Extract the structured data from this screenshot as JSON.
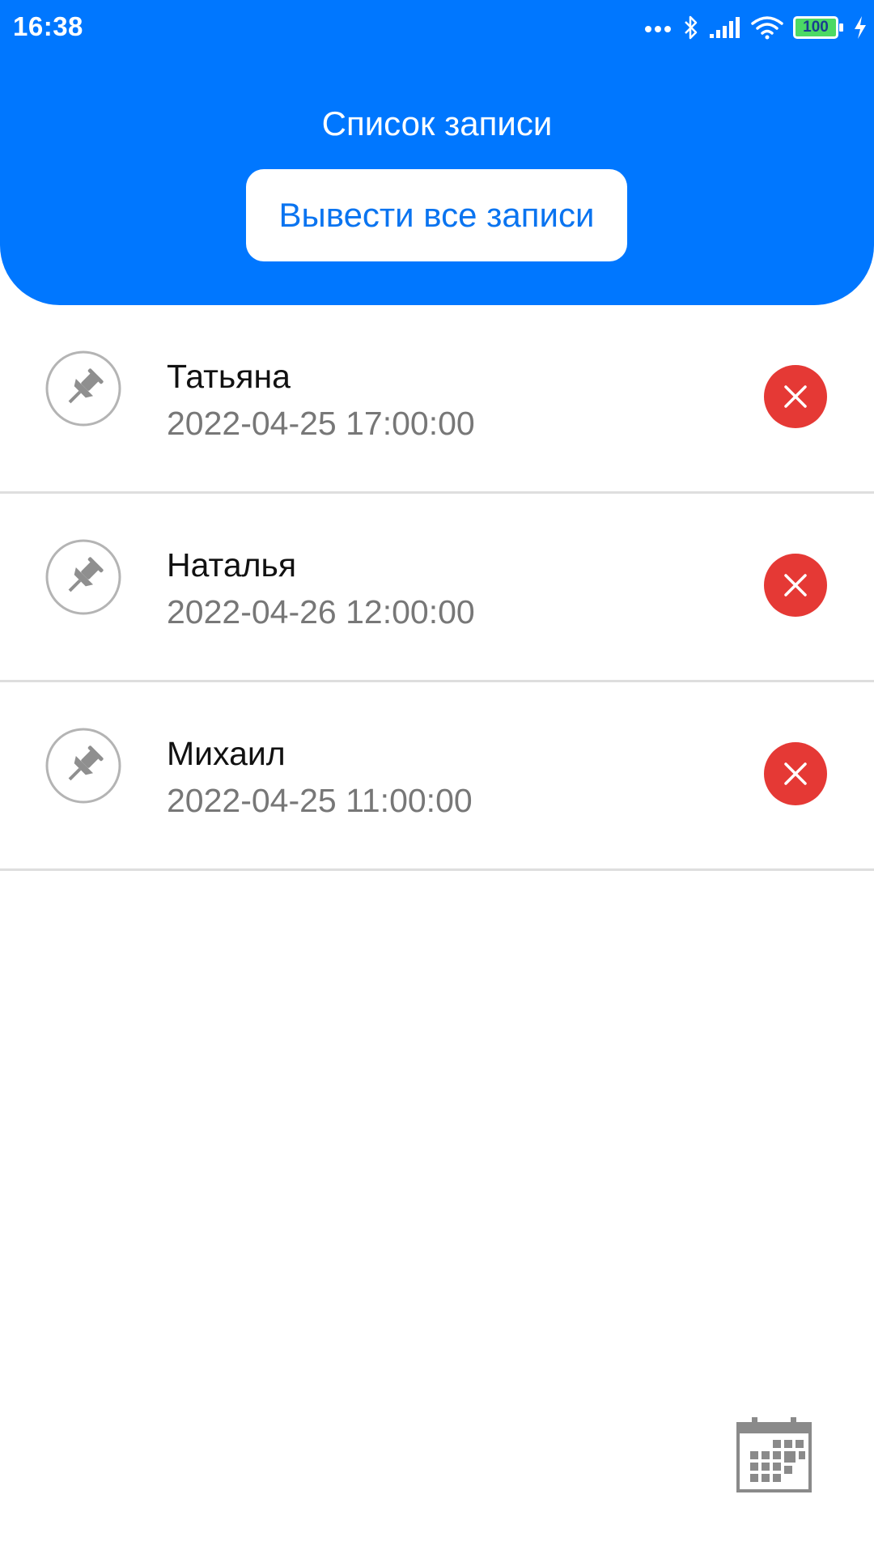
{
  "status_bar": {
    "time": "16:38",
    "battery_level": "100",
    "icons": [
      "more-dots-icon",
      "bluetooth-icon",
      "signal-icon",
      "wifi-icon",
      "battery-icon",
      "charging-icon"
    ]
  },
  "header": {
    "title": "Список записи",
    "show_all_label": "Вывести все записи"
  },
  "records": [
    {
      "name": "Татьяна",
      "datetime": "2022-04-25 17:00:00",
      "icon": "pin-icon",
      "action_icon": "close-icon"
    },
    {
      "name": "Наталья",
      "datetime": "2022-04-26 12:00:00",
      "icon": "pin-icon",
      "action_icon": "close-icon"
    },
    {
      "name": "Михаил",
      "datetime": "2022-04-25 11:00:00",
      "icon": "pin-icon",
      "action_icon": "close-icon"
    }
  ],
  "fab": {
    "icon": "calendar-icon"
  },
  "colors": {
    "primary": "#0077ff",
    "button_text": "#0a74f0",
    "delete": "#e53935",
    "divider": "#dedede",
    "secondary_text": "#777777",
    "icon_gray": "#9e9e9e",
    "battery_fill": "#4cd964"
  }
}
